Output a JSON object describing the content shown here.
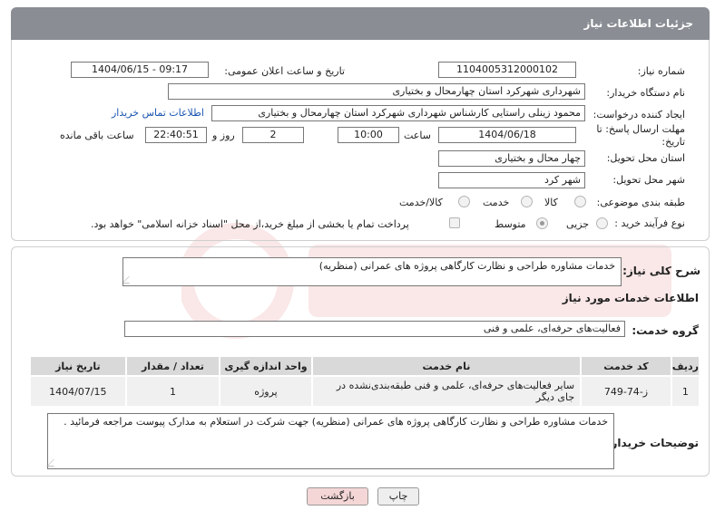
{
  "header": {
    "title": "جزئیات اطلاعات نیاز"
  },
  "form": {
    "need_number_label": "شماره نیاز:",
    "need_number": "1104005312000102",
    "announce_label": "تاریخ و ساعت اعلان عمومی:",
    "announce_value": "1404/06/15 - 09:17",
    "buyer_org_label": "نام دستگاه خریدار:",
    "buyer_org": "شهرداری شهرکرد استان چهارمحال و بختیاری",
    "creator_label": "ایجاد کننده درخواست:",
    "creator": "محمود زینلی راستایی کارشناس شهرداری شهرکرد استان چهارمحال و بختیاری",
    "contact_link": "اطلاعات تماس خریدار",
    "deadline_label_1": "مهلت ارسال پاسخ: تا",
    "deadline_label_2": "تاریخ:",
    "deadline_date": "1404/06/18",
    "time_label": "ساعت",
    "deadline_time": "10:00",
    "days_value": "2",
    "days_label": "روز و",
    "remaining_time": "22:40:51",
    "remaining_label": "ساعت باقی مانده",
    "province_label": "استان محل تحویل:",
    "province": "چهار محال و بختیاری",
    "city_label": "شهر محل تحویل:",
    "city": "شهر کرد",
    "category_label": "طبقه بندی موضوعی:",
    "category_options": [
      "کالا",
      "خدمت",
      "کالا/خدمت"
    ],
    "purchase_type_label": "نوع فرآیند خرید :",
    "purchase_options": [
      "جزیی",
      "متوسط"
    ],
    "treasury_note": "پرداخت تمام یا بخشی از مبلغ خرید،از محل \"اسناد خزانه اسلامی\" خواهد بود."
  },
  "summary": {
    "label": "شرح کلی نیاز:",
    "text": "خدمات مشاوره طراحی و نظارت کارگاهی پروژه های عمرانی (منظریه)"
  },
  "services": {
    "title": "اطلاعات خدمات مورد نیاز",
    "group_label": "گروه خدمت:",
    "group_value": "فعالیت‌های حرفه‌ای، علمی و فنی",
    "columns": [
      "ردیف",
      "کد خدمت",
      "نام خدمت",
      "واحد اندازه گیری",
      "تعداد / مقدار",
      "تاریخ نیاز"
    ],
    "rows": [
      {
        "index": "1",
        "code": "ز-74-749",
        "name": "سایر فعالیت‌های حرفه‌ای، علمی و فنی طبقه‌بندی‌نشده در جای دیگر",
        "unit": "پروژه",
        "qty": "1",
        "date": "1404/07/15"
      }
    ]
  },
  "buyer_notes": {
    "label": "توضیحات خریدار:",
    "text": "خدمات مشاوره طراحی و نظارت کارگاهی پروژه های عمرانی (منظریه) جهت شرکت در استعلام به مدارک پیوست مراجعه فرمائید ."
  },
  "buttons": {
    "print": "چاپ",
    "back": "بازگشت"
  },
  "colors": {
    "header_bg": "#8a8e94",
    "link": "#1a55b0",
    "back_btn": "#f5d6d6"
  }
}
